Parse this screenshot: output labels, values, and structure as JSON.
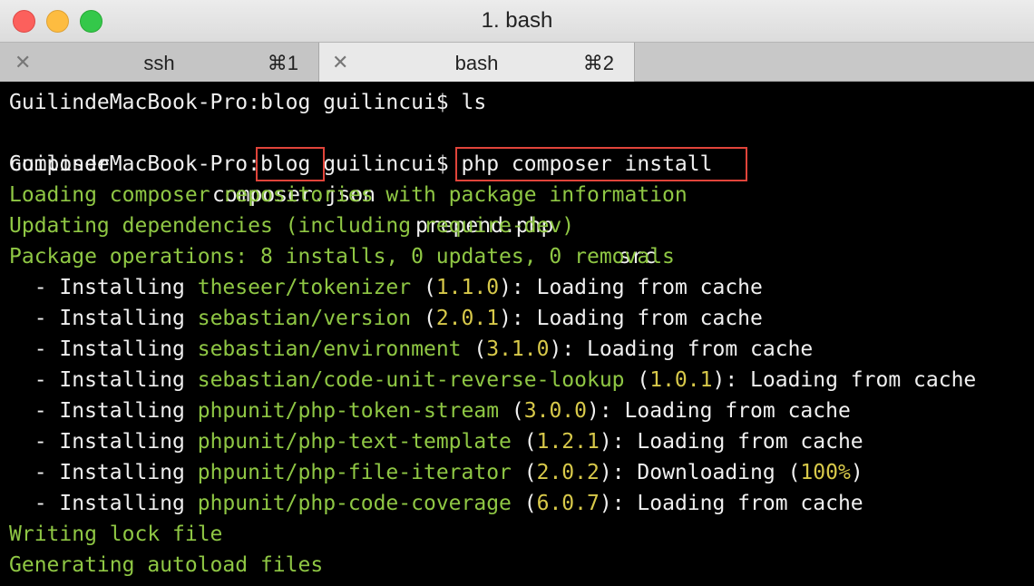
{
  "window": {
    "title": "1. bash"
  },
  "tabs": [
    {
      "label": "ssh",
      "shortcut": "⌘1",
      "close": "✕"
    },
    {
      "label": "bash",
      "shortcut": "⌘2",
      "close": "✕"
    }
  ],
  "terminal": {
    "l1": "GuilindeMacBook-Pro:blog guilincui$ ls",
    "ls": {
      "a": "composer",
      "b": "composer.json",
      "c": "prepend.php",
      "d": "src"
    },
    "prompt_host": "GuilindeMacBook-Pro:",
    "prompt_dir": "blog",
    "prompt_user": " guilincui$",
    "command": " php composer install",
    "out1": "Loading composer repositories with package information",
    "out2": "Updating dependencies (including require-dev)",
    "out3": "Package operations: 8 installs, 0 updates, 0 removals",
    "installs": [
      {
        "prefix": "  - Installing ",
        "pkg": "theseer/tokenizer",
        "ver": "1.1.0",
        "tail": "): Loading from cache"
      },
      {
        "prefix": "  - Installing ",
        "pkg": "sebastian/version",
        "ver": "2.0.1",
        "tail": "): Loading from cache"
      },
      {
        "prefix": "  - Installing ",
        "pkg": "sebastian/environment",
        "ver": "3.1.0",
        "tail": "): Loading from cache"
      },
      {
        "prefix": "  - Installing ",
        "pkg": "sebastian/code-unit-reverse-lookup",
        "ver": "1.0.1",
        "tail": "): Loading from cache"
      },
      {
        "prefix": "  - Installing ",
        "pkg": "phpunit/php-token-stream",
        "ver": "3.0.0",
        "tail": "): Loading from cache"
      },
      {
        "prefix": "  - Installing ",
        "pkg": "phpunit/php-text-template",
        "ver": "1.2.1",
        "tail": "): Loading from cache"
      },
      {
        "prefix": "  - Installing ",
        "pkg": "phpunit/php-file-iterator",
        "ver": "2.0.2",
        "tail": "): Downloading (",
        "pct": "100%",
        "tail2": ")"
      },
      {
        "prefix": "  - Installing ",
        "pkg": "phpunit/php-code-coverage",
        "ver": "6.0.7",
        "tail": "): Loading from cache"
      }
    ],
    "out4": "Writing lock file",
    "out5": "Generating autoload files",
    "open_paren": " ("
  },
  "colors": {
    "green": "#8fc744",
    "yellow": "#d8c94a",
    "highlight": "#e0443a"
  }
}
